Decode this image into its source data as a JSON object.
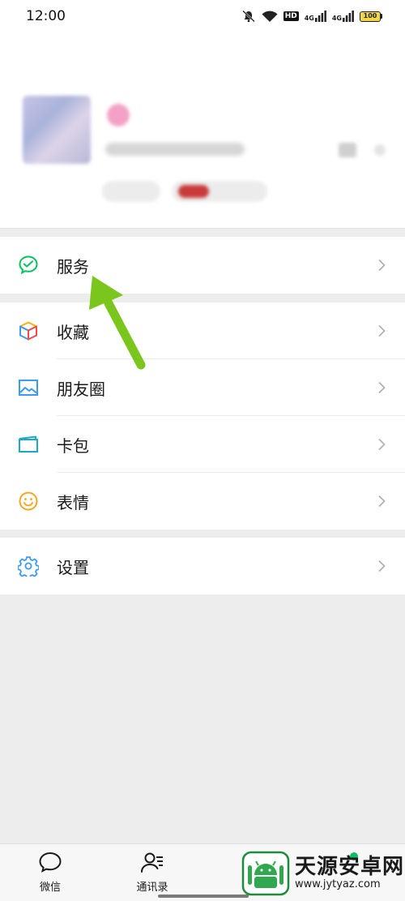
{
  "status_bar": {
    "time": "12:00",
    "hd_label": "HD",
    "signal1_label": "4G",
    "signal2_label": "4G",
    "battery_label": "100"
  },
  "icons": {
    "mute": "bell-off-icon",
    "wifi": "wifi-icon",
    "services": "wechat-pay-check-icon",
    "favorites": "cube-icon",
    "moments": "image-icon",
    "cards": "card-wallet-icon",
    "stickers": "smiley-icon",
    "settings": "gear-icon",
    "chevron": "chevron-right-icon",
    "tab_chats": "chat-bubble-icon",
    "tab_contacts": "contacts-icon",
    "tab_discover": "compass-icon"
  },
  "menu": {
    "services": {
      "label": "服务"
    },
    "favorites": {
      "label": "收藏"
    },
    "moments": {
      "label": "朋友圈"
    },
    "cards": {
      "label": "卡包"
    },
    "stickers": {
      "label": "表情"
    },
    "settings": {
      "label": "设置"
    }
  },
  "tab_bar": {
    "chats": "微信",
    "contacts": "通讯录"
  },
  "watermark": {
    "title": "天源安卓网",
    "url": "www.jytyaz.com"
  },
  "colors": {
    "wechat_green": "#07c160",
    "arrow_green": "#7bc61d",
    "background": "#ededed"
  }
}
